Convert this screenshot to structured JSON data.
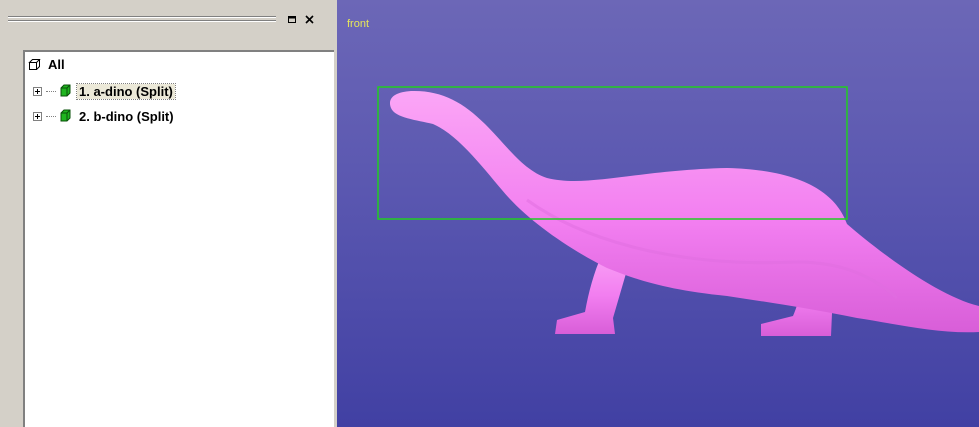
{
  "tree": {
    "root_label": "All",
    "items": [
      {
        "label": "1. a-dino (Split)",
        "selected": true
      },
      {
        "label": "2. b-dino (Split)",
        "selected": false
      }
    ],
    "restore_glyph": "▫",
    "close_glyph": "×"
  },
  "viewport": {
    "view_label": "front",
    "background_top": "#6c67b7",
    "background_bottom": "#4140a3",
    "model_color": "#f27ef0",
    "selection_box_color": "#22cc22"
  }
}
